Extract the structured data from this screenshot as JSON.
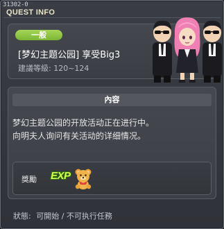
{
  "quest": {
    "id": "31302-0",
    "window_title": "QUEST INFO",
    "category": "一般",
    "name": "[梦幻主题公园] 享受Big3",
    "level_requirement": "建議等級: 120~124"
  },
  "content": {
    "header": "內容",
    "description_lines": [
      "梦幻主题公园的开放活动正在进行中。",
      "向明夫人询问有关活动的详细情况。"
    ]
  },
  "reward": {
    "label": "獎勵",
    "exp_text": "EXP"
  },
  "status": {
    "label": "狀態:",
    "value": "可開始 / 不可执行任務"
  },
  "colors": {
    "category_tag": "#8cc63f",
    "exp_text": "#d6ff4f"
  },
  "icons": {
    "npc": "npc-suits-pink-hair",
    "reward_item": "teddy-bear-icon"
  }
}
